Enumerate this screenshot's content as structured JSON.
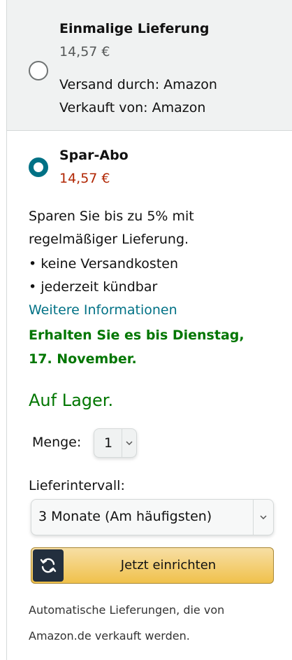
{
  "one_time": {
    "title": "Einmalige Lieferung",
    "price": "14,57 €",
    "shipped_by": "Versand durch: Amazon",
    "sold_by": "Verkauft von: Amazon"
  },
  "subscribe": {
    "title": "Spar-Abo",
    "price": "14,57 €",
    "desc_line1": "Sparen Sie bis zu 5% mit",
    "desc_line2": "regelmäßiger Lieferung.",
    "bullet1": "• keine Versandkosten",
    "bullet2": "• jederzeit kündbar",
    "more_info": "Weitere Informationen",
    "delivery_line1": "Erhalten Sie es bis Dienstag,",
    "delivery_line2": "17. November.",
    "stock": "Auf Lager.",
    "qty_label": "Menge:",
    "qty_value": "1",
    "interval_label": "Lieferintervall:",
    "interval_value": "3 Monate (Am häufigsten)",
    "button_label": "Jetzt einrichten",
    "footer_line1": "Automatische Lieferungen, die von",
    "footer_line2": "Amazon.de verkauft werden."
  },
  "colors": {
    "accent": "#007185",
    "price_red": "#b12704",
    "green": "#007600",
    "button": "#f0c14b"
  },
  "icons": {
    "refresh": "refresh-icon",
    "chevron": "chevron-down-icon"
  }
}
